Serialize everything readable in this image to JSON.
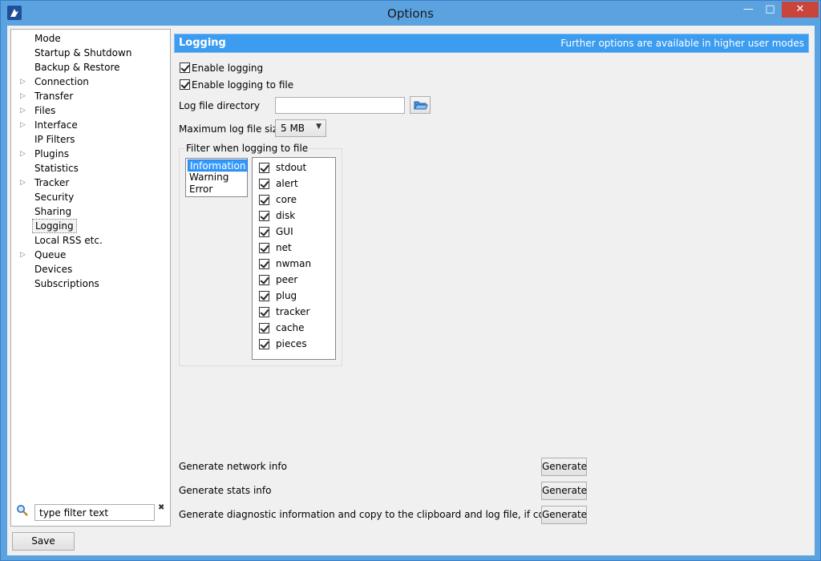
{
  "window": {
    "title": "Options",
    "min_glyph": "—",
    "max_glyph": "□",
    "close_glyph": "✕"
  },
  "sidebar": {
    "items": [
      {
        "label": "Mode",
        "expandable": false
      },
      {
        "label": "Startup & Shutdown",
        "expandable": false
      },
      {
        "label": "Backup & Restore",
        "expandable": false
      },
      {
        "label": "Connection",
        "expandable": true
      },
      {
        "label": "Transfer",
        "expandable": true
      },
      {
        "label": "Files",
        "expandable": true
      },
      {
        "label": "Interface",
        "expandable": true
      },
      {
        "label": "IP Filters",
        "expandable": false
      },
      {
        "label": "Plugins",
        "expandable": true
      },
      {
        "label": "Statistics",
        "expandable": false
      },
      {
        "label": "Tracker",
        "expandable": true
      },
      {
        "label": "Security",
        "expandable": false
      },
      {
        "label": "Sharing",
        "expandable": false
      },
      {
        "label": "Logging",
        "expandable": false,
        "selected": true
      },
      {
        "label": "Local RSS etc.",
        "expandable": false
      },
      {
        "label": "Queue",
        "expandable": true
      },
      {
        "label": "Devices",
        "expandable": false
      },
      {
        "label": "Subscriptions",
        "expandable": false
      }
    ],
    "expander_glyph": "▷",
    "filter_value": "type filter text",
    "clear_glyph": "✖"
  },
  "footer": {
    "save_label": "Save"
  },
  "header": {
    "title": "Logging",
    "note": "Further options are available in higher user modes"
  },
  "logging": {
    "enable_logging": "Enable logging",
    "enable_logging_to_file": "Enable logging to file",
    "log_dir_label": "Log file directory",
    "log_dir_value": "",
    "max_size_label": "Maximum log file size",
    "max_size_value": "5 MB",
    "filter_title": "Filter when logging to file",
    "levels": [
      "Information",
      "Warning",
      "Error"
    ],
    "components": [
      "stdout",
      "alert",
      "core",
      "disk",
      "GUI",
      "net",
      "nwman",
      "peer",
      "plug",
      "tracker",
      "cache",
      "pieces"
    ]
  },
  "generate": {
    "rows": [
      {
        "label": "Generate network info",
        "button": "Generate"
      },
      {
        "label": "Generate stats info",
        "button": "Generate"
      },
      {
        "label": "Generate diagnostic information and copy to the clipboard and log file, if configured",
        "button": "Generate"
      }
    ]
  },
  "colors": {
    "titlebar": "#5ba3e0",
    "header": "#3c9cf0",
    "close_button": "#c7453b",
    "selection": "#3399ff"
  }
}
